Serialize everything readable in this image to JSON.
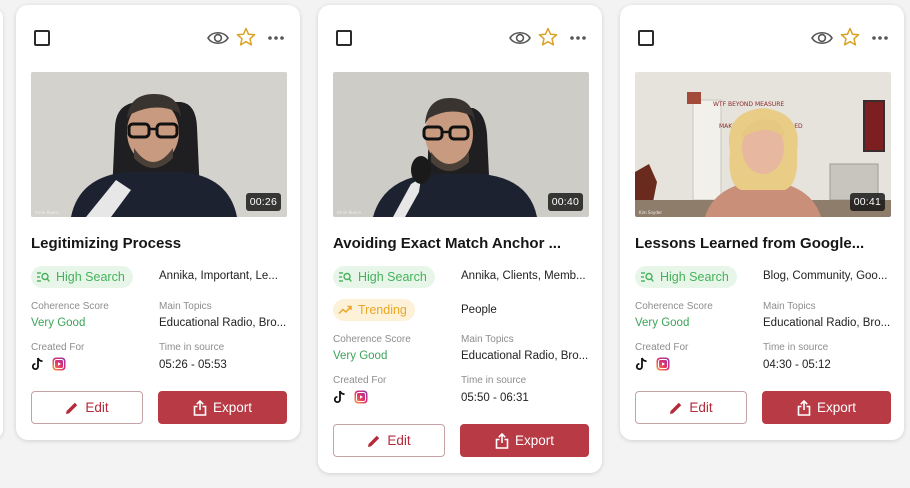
{
  "cards": [
    {
      "duration": "00:26",
      "title": "Legitimizing Process",
      "badges": [
        "High Search"
      ],
      "tags": "Annika, Important, Le...",
      "coherence_label": "Coherence Score",
      "coherence_value": "Very Good",
      "topics_label": "Main Topics",
      "topics_value": "Educational Radio, Bro...",
      "created_label": "Created For",
      "time_label": "Time in source",
      "time_value": "05:26 - 05:53",
      "edit_label": "Edit",
      "export_label": "Export"
    },
    {
      "duration": "00:40",
      "title": "Avoiding Exact Match Anchor ...",
      "badges": [
        "High Search",
        "Trending"
      ],
      "tags": "Annika, Clients, Memb...",
      "tags2": "People",
      "coherence_label": "Coherence Score",
      "coherence_value": "Very Good",
      "topics_label": "Main Topics",
      "topics_value": "Educational Radio, Bro...",
      "created_label": "Created For",
      "time_label": "Time in source",
      "time_value": "05:50 - 06:31",
      "edit_label": "Edit",
      "export_label": "Export"
    },
    {
      "duration": "00:41",
      "title": "Lessons Learned from Google...",
      "badges": [
        "High Search"
      ],
      "tags": "Blog, Community, Goo...",
      "coherence_label": "Coherence Score",
      "coherence_value": "Very Good",
      "topics_label": "Main Topics",
      "topics_value": "Educational Radio, Bro...",
      "created_label": "Created For",
      "time_label": "Time in source",
      "time_value": "04:30 - 05:12",
      "edit_label": "Edit",
      "export_label": "Export"
    }
  ],
  "icons": [
    "checkbox",
    "eye-icon",
    "star-icon",
    "more-icon",
    "search-chart-icon",
    "trending-icon",
    "tiktok-icon",
    "instagram-reels-icon",
    "pencil-icon",
    "share-icon"
  ],
  "colors": {
    "accent_red": "#b83a45",
    "green": "#3da35a",
    "search_bg": "#e8f6ea",
    "trending_bg": "#fdf1d7",
    "star": "#d9a326"
  }
}
